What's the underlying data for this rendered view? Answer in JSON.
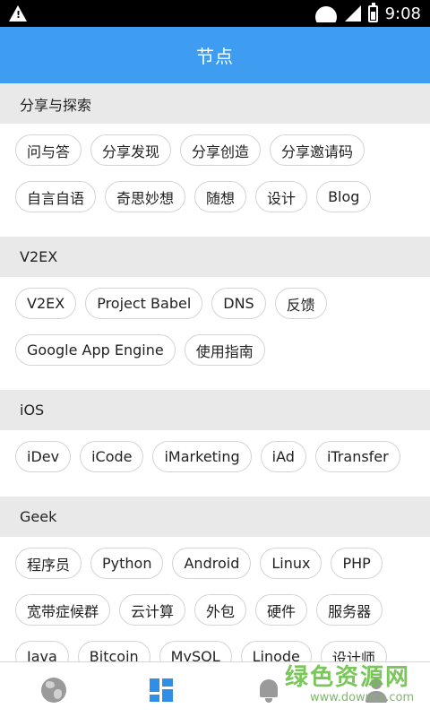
{
  "status_bar": {
    "time": "9:08"
  },
  "app_bar": {
    "title": "节点"
  },
  "sections": [
    {
      "title": "分享与探索",
      "tags": [
        "问与答",
        "分享发现",
        "分享创造",
        "分享邀请码",
        "自言自语",
        "奇思妙想",
        "随想",
        "设计",
        "Blog"
      ]
    },
    {
      "title": "V2EX",
      "tags": [
        "V2EX",
        "Project Babel",
        "DNS",
        "反馈",
        "Google App Engine",
        "使用指南"
      ]
    },
    {
      "title": "iOS",
      "tags": [
        "iDev",
        "iCode",
        "iMarketing",
        "iAd",
        "iTransfer"
      ]
    },
    {
      "title": "Geek",
      "tags": [
        "程序员",
        "Python",
        "Android",
        "Linux",
        "PHP",
        "宽带症候群",
        "云计算",
        "外包",
        "硬件",
        "服务器",
        "Java",
        "Bitcoin",
        "MySQL",
        "Linode",
        "设计师"
      ]
    }
  ],
  "bottom_nav": {
    "tabs": [
      {
        "icon": "globe-icon",
        "active": false
      },
      {
        "icon": "nodes-grid-icon",
        "active": true
      },
      {
        "icon": "bell-icon",
        "active": false
      },
      {
        "icon": "person-icon",
        "active": false
      }
    ],
    "active_color": "#2f8fe6",
    "inactive_color": "#9a9a9a"
  },
  "watermark": {
    "text": "绿色资源网",
    "url_text": "www.downcc.com"
  },
  "colors": {
    "app_bar": "#3e9df0",
    "section_header_bg": "#e9e9e9",
    "chip_border": "#d4d4d4"
  }
}
